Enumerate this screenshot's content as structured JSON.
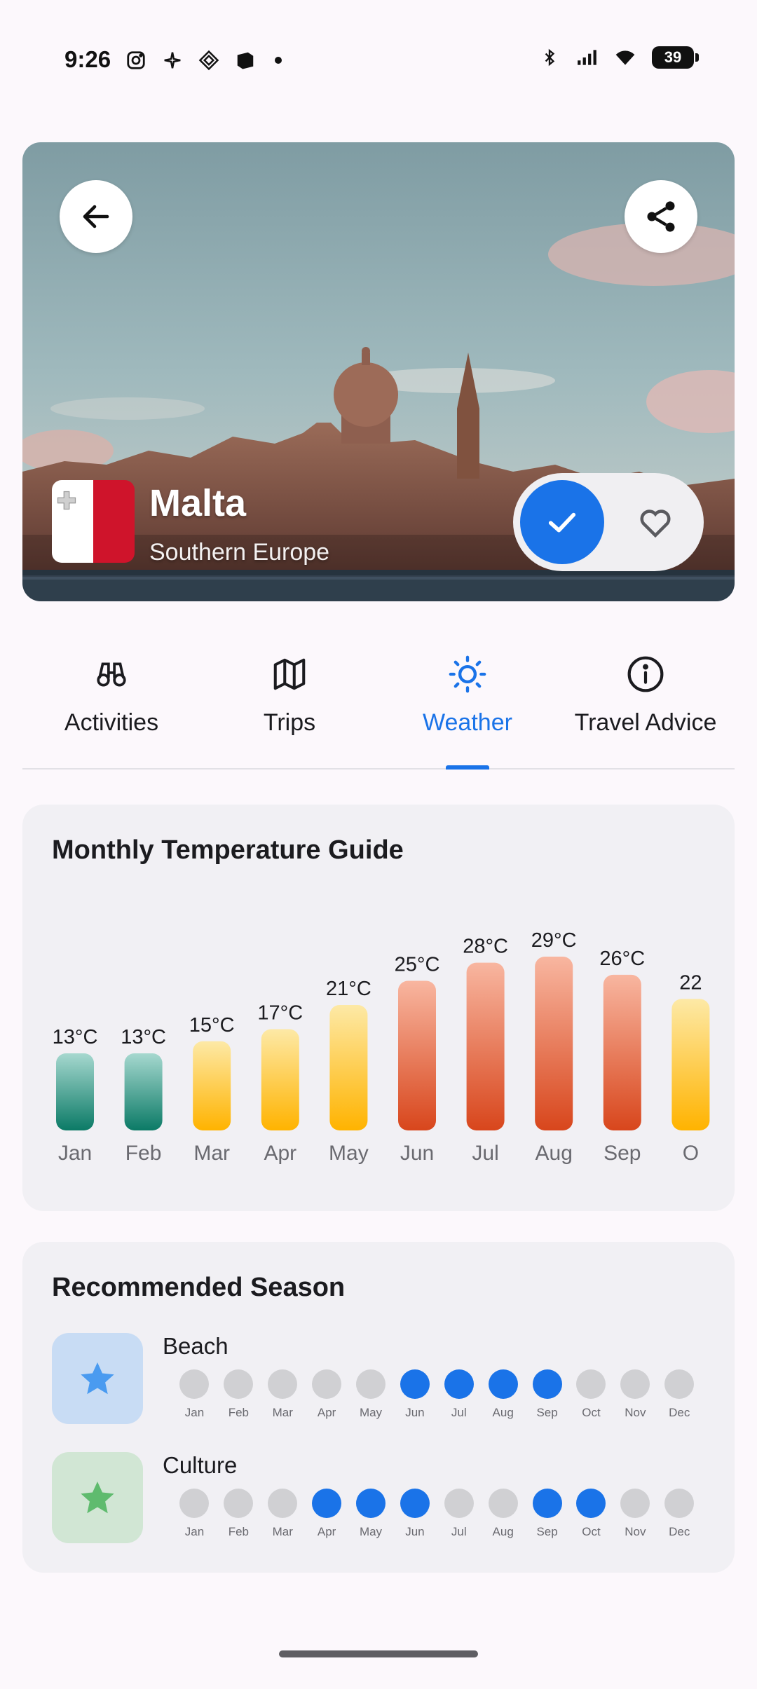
{
  "status_bar": {
    "time": "9:26",
    "battery": "39"
  },
  "destination": {
    "name": "Malta",
    "region": "Southern Europe",
    "visited": true,
    "favorite": false
  },
  "tabs": [
    {
      "label": "Activities",
      "icon": "binoculars-icon",
      "active": false
    },
    {
      "label": "Trips",
      "icon": "map-icon",
      "active": false
    },
    {
      "label": "Weather",
      "icon": "sun-icon",
      "active": true
    },
    {
      "label": "Travel Advice",
      "icon": "info-icon",
      "active": false
    }
  ],
  "temperature_card": {
    "title": "Monthly Temperature Guide"
  },
  "chart_data": {
    "type": "bar",
    "title": "Monthly Temperature Guide",
    "categories": [
      "Jan",
      "Feb",
      "Mar",
      "Apr",
      "May",
      "Jun",
      "Jul",
      "Aug",
      "Sep",
      "O"
    ],
    "values": [
      13,
      13,
      15,
      17,
      21,
      25,
      28,
      29,
      26,
      22
    ],
    "value_labels": [
      "13°C",
      "13°C",
      "15°C",
      "17°C",
      "21°C",
      "25°C",
      "28°C",
      "29°C",
      "26°C",
      "22"
    ],
    "colors": {
      "cool": [
        "#a6d8cf",
        "#0b7a66"
      ],
      "mild": [
        "#fde9a6",
        "#ffb300"
      ],
      "hot": [
        "#f8b6a0",
        "#d8461c"
      ]
    }
  },
  "season_card": {
    "title": "Recommended Season",
    "month_labels": [
      "Jan",
      "Feb",
      "Mar",
      "Apr",
      "May",
      "Jun",
      "Jul",
      "Aug",
      "Sep",
      "Oct",
      "Nov",
      "Dec"
    ],
    "seasons": [
      {
        "name": "Beach",
        "icon": "star-icon",
        "badge_bg": "#c8dcf4",
        "star_color": "#4a9bf0",
        "active_months": [
          "Jun",
          "Jul",
          "Aug",
          "Sep"
        ]
      },
      {
        "name": "Culture",
        "icon": "star-icon",
        "badge_bg": "#d1e6d4",
        "star_color": "#5fbb6e",
        "active_months": [
          "Apr",
          "May",
          "Jun",
          "Sep",
          "Oct"
        ]
      }
    ]
  },
  "colors": {
    "accent": "#1a73e8",
    "flag_red": "#cf142b"
  }
}
